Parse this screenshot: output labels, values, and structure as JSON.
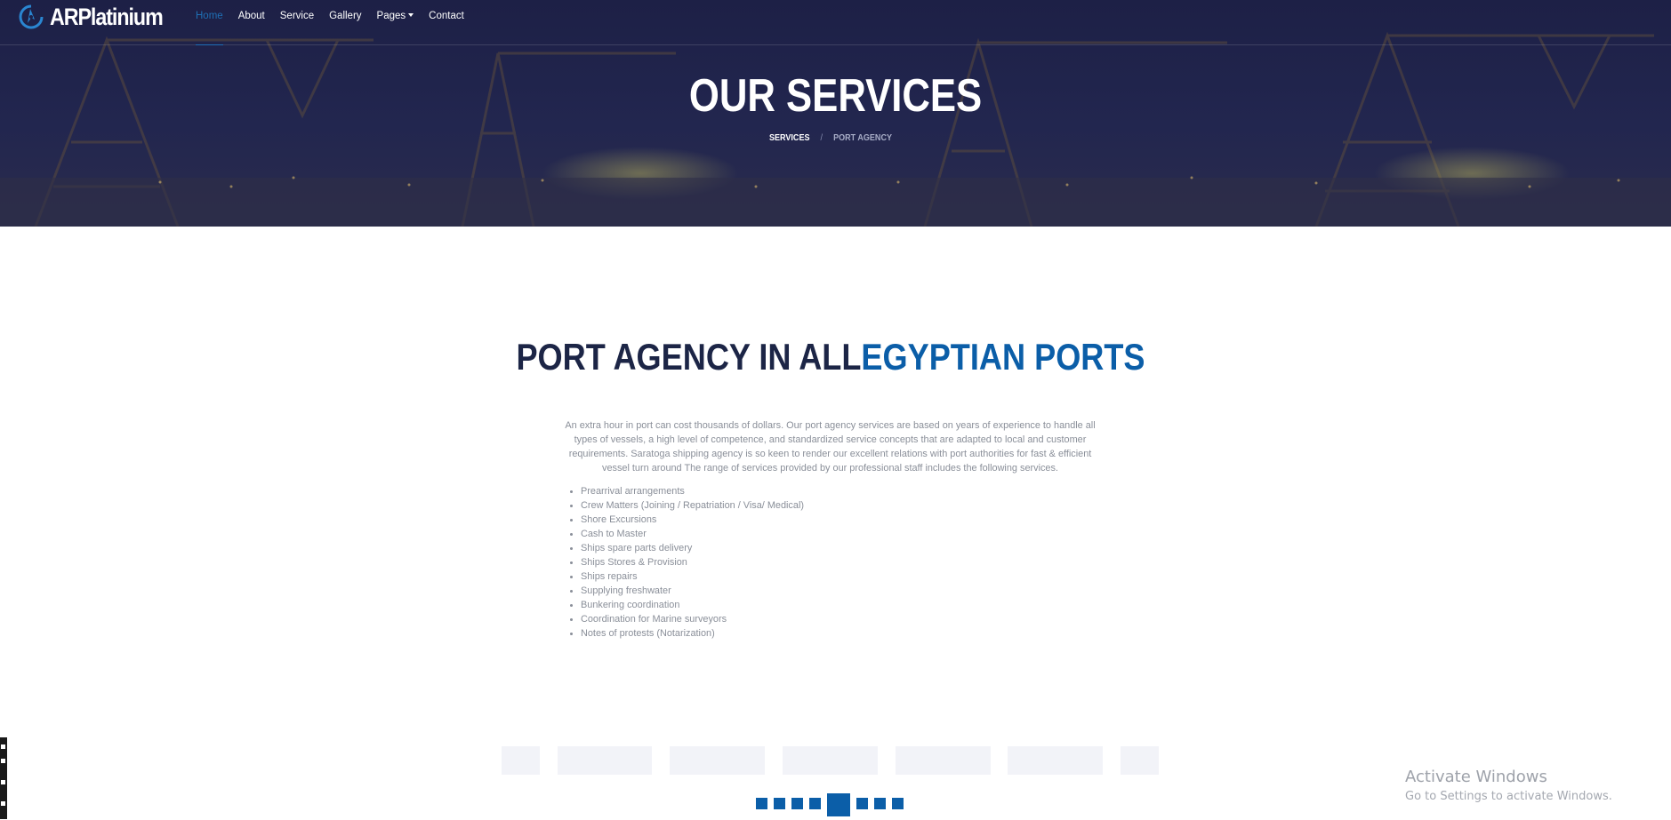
{
  "brand": {
    "name": "ARPlatinium"
  },
  "nav": {
    "items": [
      {
        "label": "Home",
        "active": true
      },
      {
        "label": "About",
        "active": false
      },
      {
        "label": "Service",
        "active": false
      },
      {
        "label": "Gallery",
        "active": false
      },
      {
        "label": "Pages",
        "active": false,
        "dropdown": true
      },
      {
        "label": "Contact",
        "active": false
      }
    ]
  },
  "hero": {
    "title": "OUR SERVICES",
    "breadcrumb": [
      "SERVICES",
      "/",
      "PORT AGENCY"
    ]
  },
  "content": {
    "heading_dark": "PORT AGENCY IN ALL",
    "heading_blue": "EGYPTIAN PORTS",
    "intro": "An extra hour in port can cost thousands of dollars. Our port agency services are based on years of experience to handle all types of vessels, a high level of competence, and standardized service concepts that are adapted to local and customer requirements. Saratoga shipping agency is so keen to render our excellent relations with port authorities for fast & efficient vessel turn around The range of services provided by our professional staff includes the following services.",
    "services": [
      "Prearrival arrangements",
      "Crew Matters (Joining / Repatriation / Visa/ Medical)",
      "Shore Excursions",
      "Cash to Master",
      "Ships spare parts delivery",
      "Ships Stores & Provision",
      "Ships repairs",
      "Supplying freshwater",
      "Bunkering coordination",
      "Coordination for Marine surveyors",
      "Notes of protests (Notarization)"
    ]
  },
  "carousel": {
    "slides": 8,
    "active_slide": 5
  },
  "windows_watermark": {
    "title": "Activate Windows",
    "subtitle": "Go to Settings to activate Windows."
  },
  "colors": {
    "hero_bg": "#1e2148",
    "accent_blue": "#0b5ea8",
    "heading_dark": "#1c2546",
    "body_text": "#8a8f99"
  }
}
